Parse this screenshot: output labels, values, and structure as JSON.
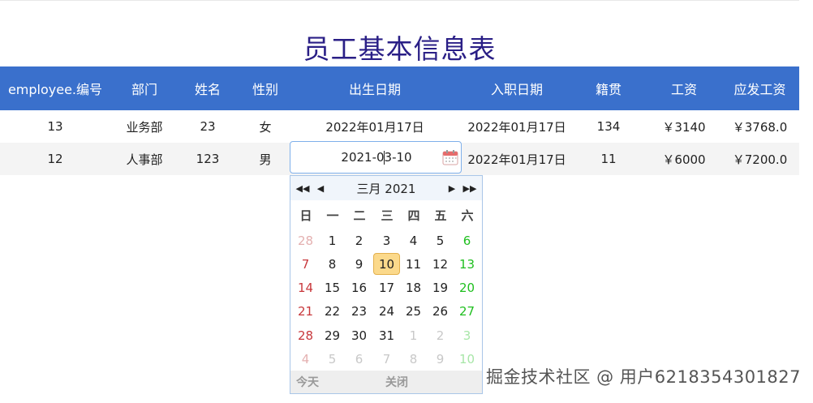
{
  "title": "员工基本信息表",
  "table": {
    "headers": [
      "employee.编号",
      "部门",
      "姓名",
      "性别",
      "出生日期",
      "入职日期",
      "籍贯",
      "工资",
      "应发工资"
    ],
    "rows": [
      [
        "13",
        "业务部",
        "23",
        "女",
        "2022年01月17日",
        "2022年01月17日",
        "134",
        "￥3140",
        "￥3768.0"
      ],
      [
        "12",
        "人事部",
        "123",
        "男",
        "2021-03-10",
        "2022年01月17日",
        "11",
        "￥6000",
        "￥7200.0"
      ]
    ]
  },
  "date_input": {
    "before_caret": "2021-0",
    "after_caret": "3-10",
    "calendar_icon": "calendar-icon"
  },
  "datepicker": {
    "month_year": "三月 2021",
    "nav": [
      "◀◀",
      "◀",
      "▶",
      "▶▶"
    ],
    "weekdays": [
      "日",
      "一",
      "二",
      "三",
      "四",
      "五",
      "六"
    ],
    "weeks": [
      [
        "28",
        "1",
        "2",
        "3",
        "4",
        "5",
        "6"
      ],
      [
        "7",
        "8",
        "9",
        "10",
        "11",
        "12",
        "13"
      ],
      [
        "14",
        "15",
        "16",
        "17",
        "18",
        "19",
        "20"
      ],
      [
        "21",
        "22",
        "23",
        "24",
        "25",
        "26",
        "27"
      ],
      [
        "28",
        "29",
        "30",
        "31",
        "1",
        "2",
        "3"
      ],
      [
        "4",
        "5",
        "6",
        "7",
        "8",
        "9",
        "10"
      ]
    ],
    "selected": "10",
    "today_label": "今天",
    "close_label": "关闭"
  },
  "watermark": "掘金技术社区 @ 用户6218354301827",
  "colors": {
    "header_bg": "#3a70cc",
    "title": "#2a1f86",
    "selected_bg": "#fbd98b",
    "sunday": "#c8383c",
    "saturday": "#1fbf1f"
  }
}
